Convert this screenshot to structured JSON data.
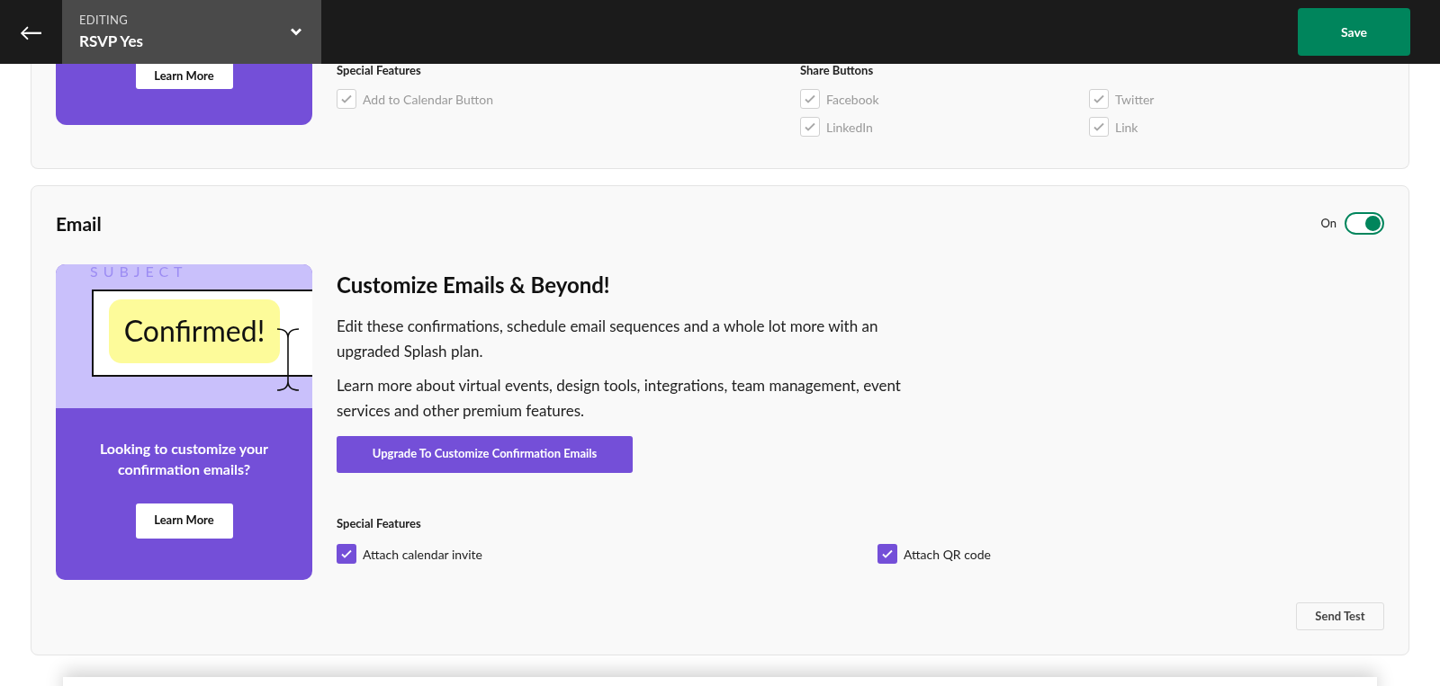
{
  "header": {
    "back": "←",
    "eyebrow": "EDITING",
    "title": "RSVP Yes",
    "save": "Save"
  },
  "rsvp_card": {
    "promo_button": "Learn More",
    "special_features": {
      "heading": "Special Features",
      "items": [
        {
          "label": "Add to Calendar Button",
          "checked": true,
          "disabled": true
        }
      ]
    },
    "share_buttons": {
      "heading": "Share Buttons",
      "items": [
        {
          "label": "Facebook",
          "checked": true,
          "disabled": true
        },
        {
          "label": "Twitter",
          "checked": true,
          "disabled": true
        },
        {
          "label": "LinkedIn",
          "checked": true,
          "disabled": true
        },
        {
          "label": "Link",
          "checked": true,
          "disabled": true
        }
      ]
    }
  },
  "email_card": {
    "title": "Email",
    "toggle": {
      "label": "On",
      "on": true
    },
    "promo": {
      "subject_label": "SUBJECT",
      "sample": "Confirmed!",
      "text": "Looking to customize your confirmation emails?",
      "button": "Learn More"
    },
    "heading": "Customize Emails & Beyond!",
    "paragraphs": [
      "Edit these confirmations, schedule email sequences and a whole lot more with an upgraded Splash plan.",
      "Learn more about virtual events, design tools, integrations, team management, event services and other premium features."
    ],
    "upgrade_button": "Upgrade To Customize Confirmation Emails",
    "special_features": {
      "heading": "Special Features",
      "items": [
        {
          "label": "Attach calendar invite",
          "checked": true,
          "disabled": false
        },
        {
          "label": "Attach QR code",
          "checked": true,
          "disabled": false
        }
      ]
    },
    "send_test": "Send Test"
  }
}
